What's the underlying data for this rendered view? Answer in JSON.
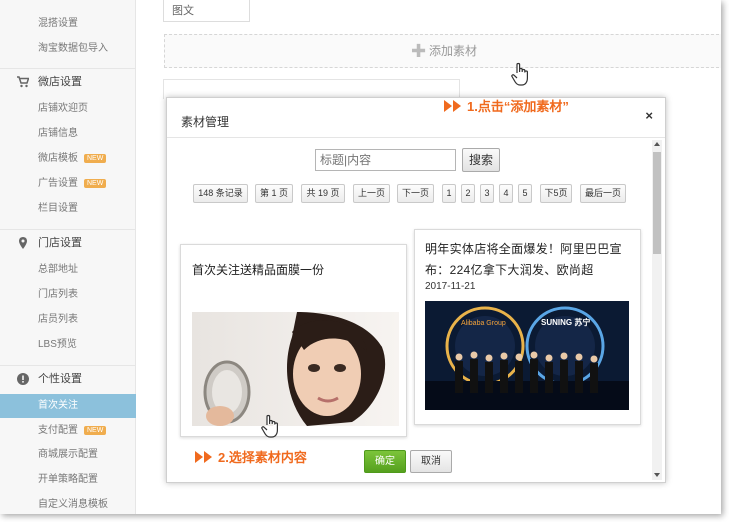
{
  "sidebar": {
    "items_top": [
      "混搭设置",
      "淘宝数据包导入"
    ],
    "section_wechat": "微店设置",
    "wechat_items": [
      "店铺欢迎页",
      "店铺信息",
      "微店模板",
      "广告设置",
      "栏目设置"
    ],
    "section_store": "门店设置",
    "store_items": [
      "总部地址",
      "门店列表",
      "店员列表",
      "LBS预览"
    ],
    "section_personal": "个性设置",
    "personal_items": [
      "首次关注",
      "支付配置",
      "商城展示配置",
      "开单策略配置",
      "自定义消息模板"
    ],
    "new_badge": "NEW"
  },
  "main": {
    "select_value": "图文",
    "add_material": "添加素材"
  },
  "modal": {
    "title": "素材管理",
    "close": "×",
    "search_placeholder": "标题|内容",
    "search_button": "搜索",
    "pager": {
      "records": "148 条记录",
      "page": "第 1 页",
      "total": "共 19 页",
      "prev": "上一页",
      "next": "下一页",
      "pages": [
        "1",
        "2",
        "3",
        "4",
        "5"
      ],
      "next5": "下5页",
      "last": "最后一页"
    },
    "card1_title": "首次关注送精品面膜一份",
    "card2_title": "明年实体店将全面爆发！阿里巴巴宣布：224亿拿下大润发、欧尚超",
    "card2_date": "2017-11-21",
    "card2_logo_left": "Alibaba Group",
    "card2_logo_right": "SUNING 苏宁",
    "ok": "确定",
    "cancel": "取消"
  },
  "annotations": {
    "step1": "1.点击“添加素材”",
    "step2": "2.选择素材内容"
  },
  "colors": {
    "accent": "#f06a1e",
    "active_item": "#8cc1dc",
    "ok_button": "#6bb32c"
  }
}
